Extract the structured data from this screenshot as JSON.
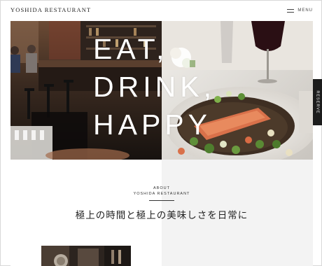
{
  "header": {
    "site_title": "YOSHIDA RESTAURANT",
    "menu_label": "MENU",
    "menu_icon": "hamburger-icon"
  },
  "hero": {
    "headline_lines": [
      "EAT,",
      "DRINK,",
      "HAPPY"
    ],
    "reserve_label": "RESERVE"
  },
  "about": {
    "kicker_line1": "ABOUT",
    "kicker_line2": "YOSHIDA RESTAURANT",
    "lead": "極上の時間と極上の美味しさを日常に"
  },
  "colors": {
    "headline": "#ffffff",
    "reserve_tab": "#1c1c1c",
    "about_background": "#f3f3f3"
  }
}
